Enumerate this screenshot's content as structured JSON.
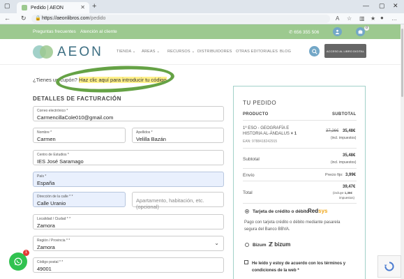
{
  "browser": {
    "tab_title": "Pedido | AEON",
    "url_host": "https://aeonlibros.com",
    "url_path": "/pedido"
  },
  "topbar": {
    "faq": "Preguntas frecuentes",
    "support": "Atención al cliente",
    "phone": "656 355 506",
    "cart_count": "0"
  },
  "header": {
    "logo": "AEON",
    "nav": [
      "TIENDA",
      "ÁREAS",
      "RECURSOS",
      "DISTRIBUIDORES",
      "OTRAS EDITORIALES",
      "BLOG"
    ],
    "access_button": "ACCESO AL LIBRO DIGITAL"
  },
  "coupon": {
    "prefix": "¿Tienes un cupón?",
    "link": "Haz clic aquí para introducir tu código"
  },
  "billing": {
    "title": "DETALLES DE FACTURACIÓN",
    "email_label": "Correo electrónico *",
    "email_value": "CarmencillaCole010@gmail.com",
    "name_label": "Nombre *",
    "name_value": "Carmen",
    "surname_label": "Apellidos *",
    "surname_value": "Velilla Bazán",
    "school_label": "Centro de Estudios *",
    "school_value": "IES José Saramago",
    "country_label": "País *",
    "country_value": "España",
    "address_label": "Dirección de la calle * *",
    "address_value": "Calle Uranio",
    "address2_placeholder": "Apartamento, habitación, etc. (opcional)",
    "city_label": "Localidad / Ciudad * *",
    "city_value": "Zamora",
    "region_label": "Región / Provincia * *",
    "region_value": "Zamora",
    "zip_label": "Código postal * *",
    "zip_value": "49001"
  },
  "order": {
    "title": "TU PEDIDO",
    "col_product": "PRODUCTO",
    "col_subtotal": "SUBTOTAL",
    "product_name": "1º ESO - GEOGRAFÍA E HISTORIA AL-ÁNDALUS",
    "product_qty": "× 1",
    "ean": "EAN: 9788418242915",
    "old_price": "37,26€",
    "new_price": "35,48€",
    "tax_note": "(incl. impuestos)",
    "subtotal_label": "Subtotal",
    "subtotal_value": "35,48€",
    "subtotal_tax": "(incl. impuestos)",
    "shipping_label": "Envío",
    "shipping_note": "Precio fijo:",
    "shipping_value": "3,99€",
    "total_label": "Total",
    "total_value": "39,47€",
    "total_tax_prefix": "(incluye",
    "total_tax_value": "1,36€",
    "total_tax_suffix": "impuestos)"
  },
  "payment": {
    "card_label": "Tarjeta de crédito o débito",
    "card_brand": "Redsys",
    "card_desc": "Pago con tarjeta crédito o débito mediante pasarela segura del Banco BBVA.",
    "bizum_label": "Bizum",
    "bizum_brand": "bizum",
    "terms": "He leído y estoy de acuerdo con los términos y condiciones de la web *"
  },
  "chat": {
    "badge": "1"
  }
}
